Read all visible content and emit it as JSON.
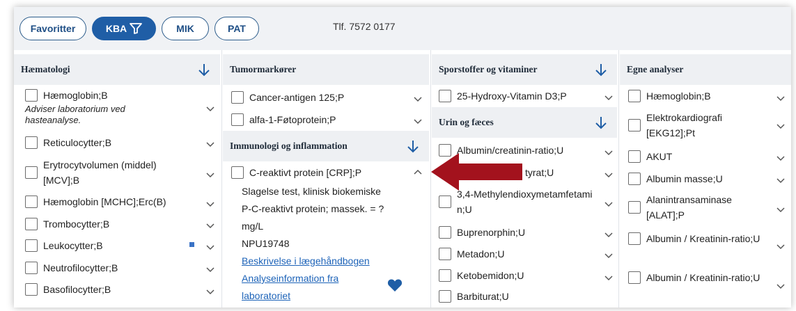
{
  "tabs": {
    "favorites": "Favoritter",
    "kba": "KBA",
    "mik": "MIK",
    "pat": "PAT"
  },
  "phone": "Tlf. 7572 0177",
  "columns": {
    "hematology": {
      "title": "Hæmatologi",
      "items": [
        "Hæmoglobin;B",
        "Reticulocytter;B",
        "Erytrocytvolumen (middel) [MCV];B",
        "Hæmoglobin [MCHC];Erc(B)",
        "Trombocytter;B",
        "Leukocytter;B",
        "Neutrofilocytter;B",
        "Basofilocytter;B"
      ],
      "note": "Adviser laboratorium ved hasteanalyse."
    },
    "tumor": {
      "title": "Tumormarkører",
      "items": [
        "Cancer-antigen 125;P",
        "alfa-1-Føtoprotein;P"
      ]
    },
    "immunology": {
      "title": "Immunologi og inflammation",
      "item": "C-reaktivt protein [CRP];P",
      "details": {
        "place": "Slagelse test, klinisk biokemiske",
        "name": "P-C-reaktivt protein; massek. = ?",
        "unit": "mg/L",
        "code": "NPU19748",
        "link1": "Beskrivelse i lægehåndbogen",
        "link2a": "Analyseinformation fra",
        "link2b": "laboratoriet"
      }
    },
    "trace": {
      "title": "Sporstoffer og vitaminer",
      "items": [
        "25-Hydroxy-Vitamin D3;P"
      ]
    },
    "urine": {
      "title": "Urin og fæces",
      "items": [
        "Albumin/creatinin-ratio;U",
        "tyrat;U",
        "3,4-Methylendioxymetamfetamin;U",
        "Buprenorphin;U",
        "Metadon;U",
        "Ketobemidon;U",
        "Barbiturat;U"
      ]
    },
    "own": {
      "title": "Egne analyser",
      "items": [
        "Hæmoglobin;B",
        "Elektrokardiografi [EKG12];Pt",
        "AKUT",
        "Albumin masse;U",
        "Alanintransaminase [ALAT];P",
        "Albumin / Kreatinin-ratio;U",
        "Albumin / Kreatinin-ratio;U"
      ]
    }
  },
  "colors": {
    "accent": "#1f5ea6",
    "link": "#1d63b8",
    "annotation_arrow": "#a3121d"
  },
  "icons": [
    "filter-icon",
    "arrow-down-icon",
    "chevron-down-icon",
    "chevron-up-icon",
    "heart-icon",
    "square-marker-icon"
  ]
}
